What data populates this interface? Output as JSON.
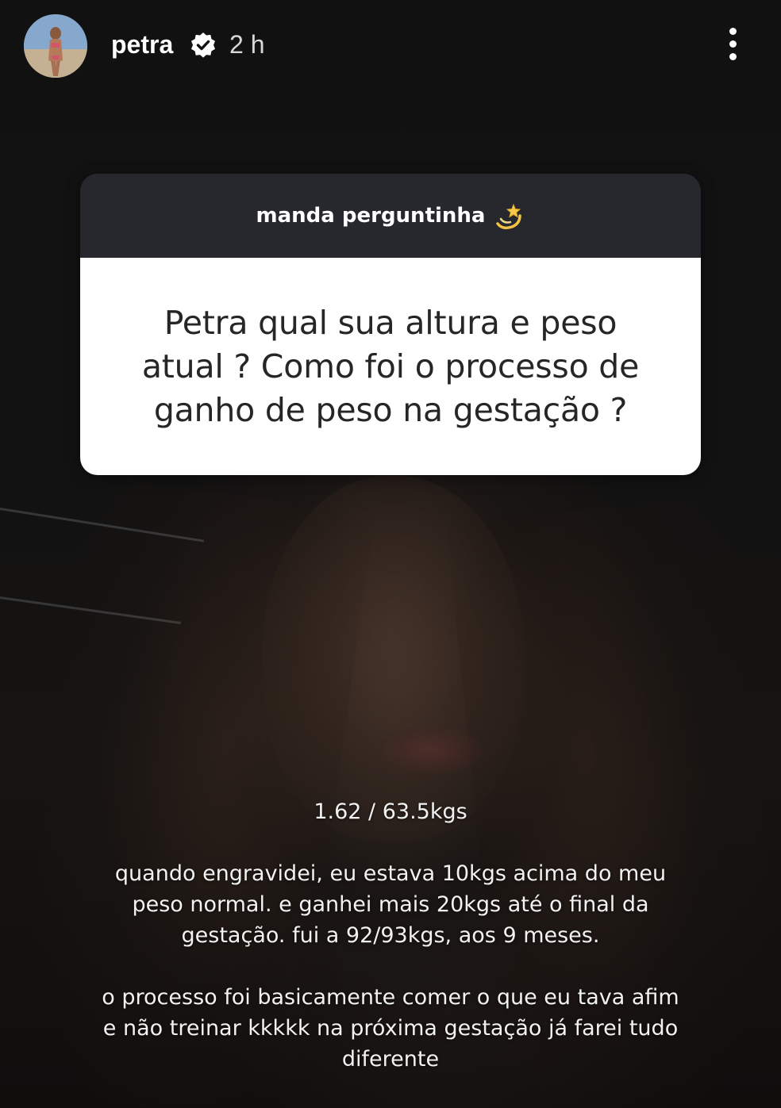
{
  "header": {
    "username": "petra",
    "timestamp": "2 h",
    "avatar_icon": "profile-photo-icon",
    "verified_icon": "verified-badge-icon",
    "more_icon": "more-vertical-icon"
  },
  "question_sticker": {
    "title": "manda perguntinha",
    "title_emoji": "dizzy-emoji-icon",
    "question": "Petra qual sua altura e peso atual ? Como foi o processo de ganho de peso na gestação ?"
  },
  "answer": {
    "stats": "1.62 / 63.5kgs",
    "paragraph_1": "quando engravidei, eu estava 10kgs acima do meu peso normal. e ganhei mais 20kgs até o final da gestação. fui a 92/93kgs, aos 9 meses.",
    "paragraph_2": "o processo foi basicamente comer o que eu tava afim e não treinar kkkkk na próxima gestação já farei tudo diferente"
  },
  "colors": {
    "background": "#121212",
    "sticker_header": "#26282d",
    "sticker_body": "#ffffff",
    "text_light": "#ffffff"
  }
}
